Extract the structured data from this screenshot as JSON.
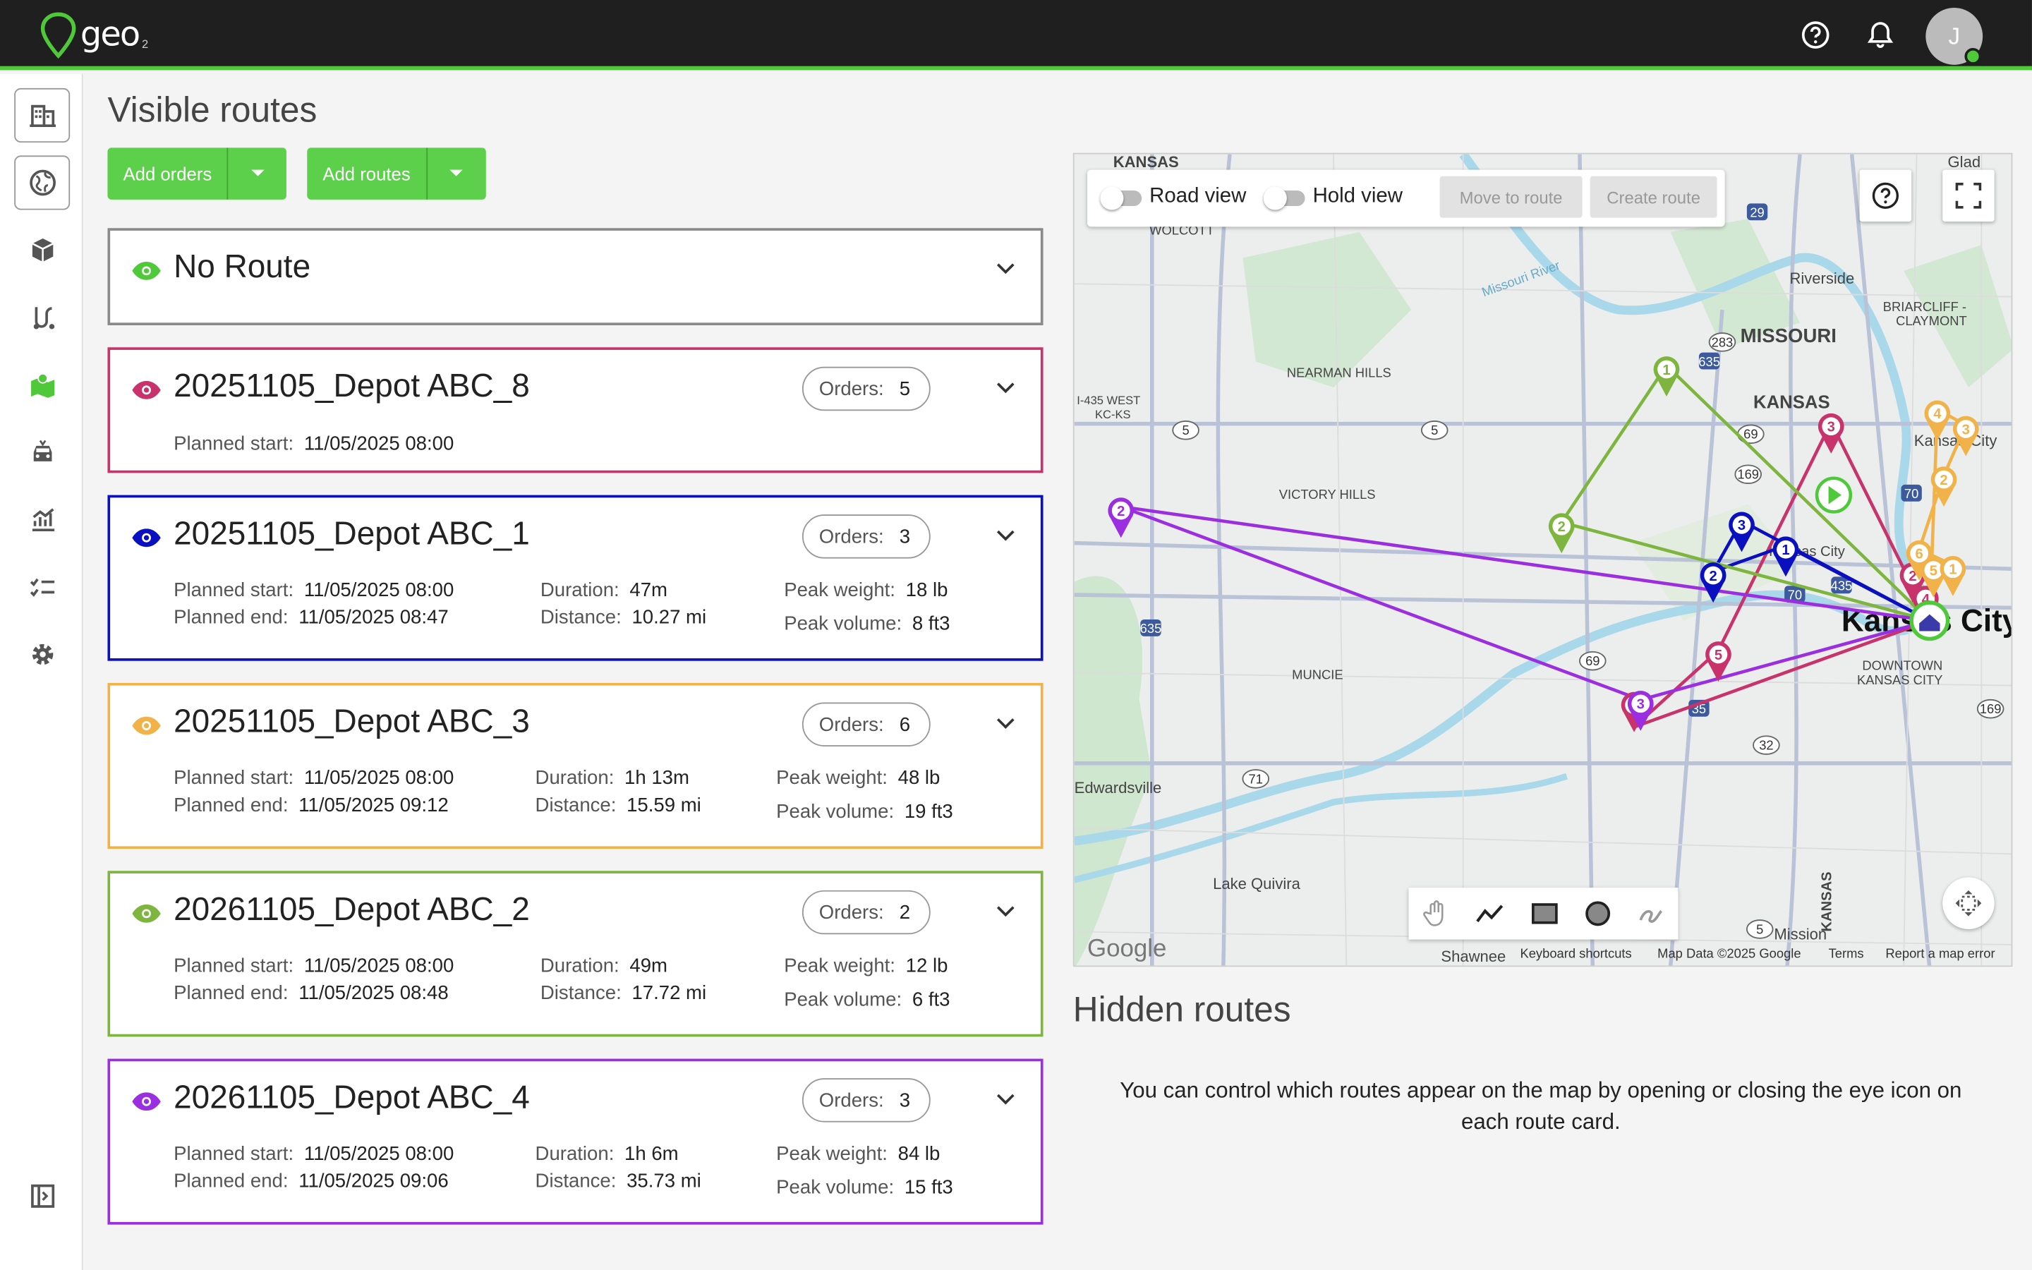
{
  "app": {
    "name": "geo",
    "name_sub": "2",
    "user_initial": "J"
  },
  "icons": {
    "help": "help-circle-icon",
    "bell": "bell-icon"
  },
  "sidebar": {
    "items": [
      {
        "icon": "buildings-icon",
        "name": "sidebar-item-depots"
      },
      {
        "icon": "globe-icon",
        "name": "sidebar-item-regions"
      },
      {
        "icon": "box-icon",
        "name": "sidebar-item-orders"
      },
      {
        "icon": "route-icon",
        "name": "sidebar-item-routes"
      },
      {
        "icon": "map-icon",
        "name": "sidebar-item-map"
      },
      {
        "icon": "car-icon",
        "name": "sidebar-item-vehicles"
      },
      {
        "icon": "chart-icon",
        "name": "sidebar-item-analytics"
      },
      {
        "icon": "checklist-icon",
        "name": "sidebar-item-tasks"
      },
      {
        "icon": "gear-icon",
        "name": "sidebar-item-settings"
      }
    ],
    "collapse_icon": "sidebar-collapse-icon"
  },
  "main": {
    "title": "Visible routes",
    "add_orders": "Add orders",
    "add_routes": "Add routes"
  },
  "labels": {
    "orders": "Orders:",
    "planned_start": "Planned start:",
    "planned_end": "Planned end:",
    "duration": "Duration:",
    "distance": "Distance:",
    "peak_weight": "Peak weight:",
    "peak_volume": "Peak volume:"
  },
  "no_route": {
    "name": "No Route",
    "color": "#999999"
  },
  "routes": [
    {
      "name": "20251105_Depot ABC_8",
      "color": "#c8336b",
      "orders": "5",
      "planned_start": "11/05/2025 08:00"
    },
    {
      "name": "20251105_Depot ABC_1",
      "color": "#0a10c0",
      "orders": "3",
      "planned_start": "11/05/2025 08:00",
      "planned_end": "11/05/2025 08:47",
      "duration": "47m",
      "distance": "10.27 mi",
      "peak_weight": "18 lb",
      "peak_volume": "8 ft3"
    },
    {
      "name": "20251105_Depot ABC_3",
      "color": "#f2b24a",
      "orders": "6",
      "planned_start": "11/05/2025 08:00",
      "planned_end": "11/05/2025 09:12",
      "duration": "1h 13m",
      "distance": "15.59 mi",
      "peak_weight": "48 lb",
      "peak_volume": "19 ft3"
    },
    {
      "name": "20261105_Depot ABC_2",
      "color": "#7db53f",
      "orders": "2",
      "planned_start": "11/05/2025 08:00",
      "planned_end": "11/05/2025 08:48",
      "duration": "49m",
      "distance": "17.72 mi",
      "peak_weight": "12 lb",
      "peak_volume": "6 ft3"
    },
    {
      "name": "20261105_Depot ABC_4",
      "color": "#9b2ee0",
      "orders": "3",
      "planned_start": "11/05/2025 08:00",
      "planned_end": "11/05/2025 09:06",
      "duration": "1h 6m",
      "distance": "35.73 mi",
      "peak_weight": "84 lb",
      "peak_volume": "15 ft3"
    }
  ],
  "map": {
    "road_view": "Road view",
    "hold_view": "Hold view",
    "move_to_route": "Move to route",
    "create_route": "Create route",
    "place_labels": [
      "KANSAS",
      "WOLCOTT",
      "Riverside",
      "BRIARCLIFF -",
      "CLAYMONT",
      "MISSOURI",
      "NEARMAN HILLS",
      "KANSAS",
      "I-435 WEST",
      "KC-KS",
      "Kansas City",
      "VICTORY HILLS",
      "Kansas City",
      "Kansas City",
      "DOWNTOWN",
      "KANSAS CITY",
      "MUNCIE",
      "Edwardsville",
      "Lake Quivira",
      "Mission",
      "Shawnee",
      "KANSAS",
      "Glad",
      "Missouri River"
    ],
    "road_labels": [
      "29",
      "635",
      "283",
      "5",
      "5",
      "69",
      "169",
      "70",
      "70",
      "435",
      "635",
      "69",
      "35",
      "32",
      "71",
      "169",
      "5"
    ],
    "google": "Google",
    "attribution": {
      "shortcuts": "Keyboard shortcuts",
      "data": "Map Data ©2025 Google",
      "terms": "Terms",
      "report": "Report a map error"
    }
  },
  "hidden": {
    "title": "Hidden routes",
    "message": "You can control which routes appear on the map by opening or closing the eye icon on each route card."
  }
}
